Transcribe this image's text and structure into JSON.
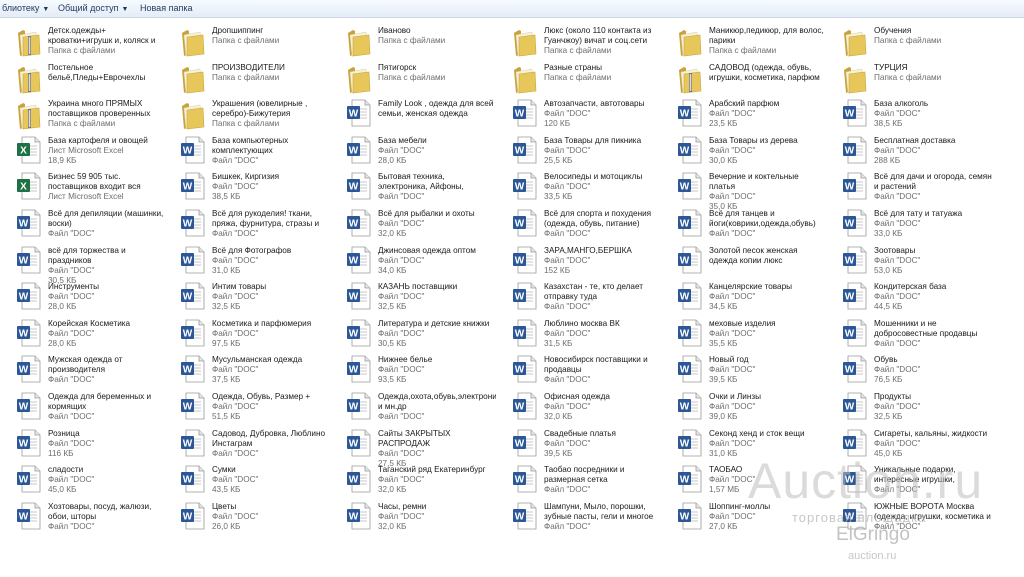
{
  "toolbar": {
    "buttons": [
      {
        "label": "блиотеку",
        "dropdown": true
      },
      {
        "label": "Общий доступ",
        "dropdown": true
      },
      {
        "label": "Новая папка",
        "dropdown": false
      }
    ]
  },
  "colors": {
    "folder": "#e8c75a",
    "word": "#2b5797",
    "excel": "#1e7145"
  },
  "files": [
    {
      "name": "Детск.одежды+ кроватки+игрушк и, коляск и многое другое",
      "sub": "Папка с файлами",
      "icon": "folder-zip-icon"
    },
    {
      "name": "Постельное бельё,Пледы+Еврочехлы",
      "sub": "",
      "icon": "folder-zip-icon"
    },
    {
      "name": "Украина много ПРЯМЫХ поставщиков проверенных",
      "sub": "Папка с файлами",
      "icon": "folder-zip-icon"
    },
    {
      "name": "База картофеля и овощей",
      "sub": "Лист Microsoft Excel",
      "size": "18,9 КБ",
      "icon": "excel-icon"
    },
    {
      "name": "Бизнес 59 905 тыс. поставщиков входит вся Россия",
      "sub": "Лист Microsoft Excel",
      "icon": "excel-icon"
    },
    {
      "name": "Всё для депиляции (машинки, воски)",
      "sub": "Файл \"DOC\"",
      "icon": "word-icon"
    },
    {
      "name": "всё для торжества и праздников",
      "sub": "Файл \"DOC\"",
      "size": "30,5 КБ",
      "icon": "word-icon"
    },
    {
      "name": "Инструменты",
      "sub": "Файл \"DOC\"",
      "size": "28,0 КБ",
      "icon": "word-icon"
    },
    {
      "name": "Корейская Косметика",
      "sub": "Файл \"DOC\"",
      "size": "28,0 КБ",
      "icon": "word-icon"
    },
    {
      "name": "Мужская одежда от производителя",
      "sub": "Файл \"DOC\"",
      "icon": "word-icon"
    },
    {
      "name": "Одежда для беременных и кормящих",
      "sub": "Файл \"DOC\"",
      "icon": "word-icon"
    },
    {
      "name": "Розница",
      "sub": "Файл \"DOC\"",
      "size": "116 КБ",
      "icon": "word-icon"
    },
    {
      "name": "сладости",
      "sub": "Файл \"DOC\"",
      "size": "45,0 КБ",
      "icon": "word-icon"
    },
    {
      "name": "Хозтовары, посуд, жалюзи, обои, шторы",
      "sub": "Файл \"DOC\"",
      "icon": "word-icon"
    },
    {
      "name": "Дропшиппинг",
      "sub": "Папка с файлами",
      "icon": "folder-icon"
    },
    {
      "name": "ПРОИЗВОДИТЕЛИ",
      "sub": "Папка с файлами",
      "icon": "folder-icon"
    },
    {
      "name": "Украшения (ювелирные , серебро)-Бижутерия",
      "sub": "Папка с файлами",
      "icon": "folder-icon"
    },
    {
      "name": "База компьютерных комплектующих",
      "sub": "Файл \"DOC\"",
      "icon": "word-icon"
    },
    {
      "name": "Бишкек, Киргизия",
      "sub": "Файл \"DOC\"",
      "size": "38,5 КБ",
      "icon": "word-icon"
    },
    {
      "name": "Всё для рукоделия! ткани, пряжа, фурнитура, стразы и многое др...",
      "sub": "Файл \"DOC\"",
      "icon": "word-icon"
    },
    {
      "name": "Всё для Фотографов",
      "sub": "Файл \"DOC\"",
      "size": "31,0 КБ",
      "icon": "word-icon"
    },
    {
      "name": "Интим товары",
      "sub": "Файл \"DOC\"",
      "size": "32,5 КБ",
      "icon": "word-icon"
    },
    {
      "name": "Косметика и парфюмерия",
      "sub": "Файл \"DOC\"",
      "size": "97,5 КБ",
      "icon": "word-icon"
    },
    {
      "name": "Мусульманская одежда",
      "sub": "Файл \"DOC\"",
      "size": "37,5 КБ",
      "icon": "word-icon"
    },
    {
      "name": "Одежда, Обувь, Размер +",
      "sub": "Файл \"DOC\"",
      "size": "51,5 КБ",
      "icon": "word-icon"
    },
    {
      "name": "Садовод, Дубровка, Люблино Инстаграм",
      "sub": "Файл \"DOC\"",
      "icon": "word-icon"
    },
    {
      "name": "Сумки",
      "sub": "Файл \"DOC\"",
      "size": "43,5 КБ",
      "icon": "word-icon"
    },
    {
      "name": "Цветы",
      "sub": "Файл \"DOC\"",
      "size": "26,0 КБ",
      "icon": "word-icon"
    },
    {
      "name": "Иваново",
      "sub": "Папка с файлами",
      "icon": "folder-icon"
    },
    {
      "name": "Пятигорск",
      "sub": "Папка с файлами",
      "icon": "folder-icon"
    },
    {
      "name": "Family Look , одежда для всей семьи, женская одежда",
      "sub": "",
      "icon": "word-icon"
    },
    {
      "name": "База мебели",
      "sub": "Файл \"DOC\"",
      "size": "28,0 КБ",
      "icon": "word-icon"
    },
    {
      "name": "Бытовая техника, электроника, Айфоны, смартфоны, самсунги",
      "sub": "Файл \"DOC\"",
      "icon": "word-icon"
    },
    {
      "name": "Всё для рыбалки и охоты",
      "sub": "Файл \"DOC\"",
      "size": "32,0 КБ",
      "icon": "word-icon"
    },
    {
      "name": "Джинсовая одежда оптом",
      "sub": "Файл \"DOC\"",
      "size": "34,0 КБ",
      "icon": "word-icon"
    },
    {
      "name": "КАЗАНЬ поставщики",
      "sub": "Файл \"DOC\"",
      "size": "32,5 КБ",
      "icon": "word-icon"
    },
    {
      "name": "Литература и детские книжки",
      "sub": "Файл \"DOC\"",
      "size": "30,5 КБ",
      "icon": "word-icon"
    },
    {
      "name": "Нижнее белье",
      "sub": "Файл \"DOC\"",
      "size": "93,5 КБ",
      "icon": "word-icon"
    },
    {
      "name": "Одежда,охота,обувь,электроника и мн.др",
      "sub": "Файл \"DOC\"",
      "icon": "word-icon"
    },
    {
      "name": "Сайты ЗАКРЫТЫХ РАСПРОДАЖ",
      "sub": "Файл \"DOC\"",
      "size": "27,5 КБ",
      "icon": "word-icon"
    },
    {
      "name": "Таганский ряд Екатеринбург",
      "sub": "Файл \"DOC\"",
      "size": "32,0 КБ",
      "icon": "word-icon"
    },
    {
      "name": "Часы, ремни",
      "sub": "Файл \"DOC\"",
      "size": "32,0 КБ",
      "icon": "word-icon"
    },
    {
      "name": "Люкс (около 110 контакта из Гуанчжоу) вичат и соц.сети",
      "sub": "Папка с файлами",
      "icon": "folder-icon"
    },
    {
      "name": "Разные страны",
      "sub": "Папка с файлами",
      "icon": "folder-icon"
    },
    {
      "name": "Автозапчасти, автотовары",
      "sub": "Файл \"DOC\"",
      "size": "120 КБ",
      "icon": "word-icon"
    },
    {
      "name": "База Товары для пикника",
      "sub": "Файл \"DOC\"",
      "size": "25,5 КБ",
      "icon": "word-icon"
    },
    {
      "name": "Велосипеды и мотоциклы",
      "sub": "Файл \"DOC\"",
      "size": "33,5 КБ",
      "icon": "word-icon"
    },
    {
      "name": "Всё для спорта и похудения (одежда, обувь, питание)",
      "sub": "Файл \"DOC\"",
      "icon": "word-icon"
    },
    {
      "name": "ЗАРА,МАНГО,БЕРШКА",
      "sub": "Файл \"DOC\"",
      "size": "152 КБ",
      "icon": "word-icon"
    },
    {
      "name": "Казахстан - те, кто делает отправку туда",
      "sub": "Файл \"DOC\"",
      "icon": "word-icon"
    },
    {
      "name": "Люблино москва ВК",
      "sub": "Файл \"DOC\"",
      "size": "31,5 КБ",
      "icon": "word-icon"
    },
    {
      "name": "Новосибирск поставщики и продавцы",
      "sub": "Файл \"DOC\"",
      "icon": "word-icon"
    },
    {
      "name": "Офисная одежда",
      "sub": "Файл \"DOC\"",
      "size": "32,0 КБ",
      "icon": "word-icon"
    },
    {
      "name": "Свадебные платья",
      "sub": "Файл \"DOC\"",
      "size": "39,5 КБ",
      "icon": "word-icon"
    },
    {
      "name": "Таобао посредники и размерная сетка",
      "sub": "Файл \"DOC\"",
      "icon": "word-icon"
    },
    {
      "name": "Шампуни, Мыло, порошки, зубные пасты, гели и многое др...",
      "sub": "Файл \"DOC\"",
      "icon": "word-icon"
    },
    {
      "name": "Маникюр,педикюр, для волос, парики",
      "sub": "Папка с файлами",
      "icon": "folder-icon"
    },
    {
      "name": "САДОВОД (одежда, обувь, игрушки, косметика, парфюм и...",
      "sub": "",
      "icon": "folder-zip-icon"
    },
    {
      "name": "Арабский парфюм",
      "sub": "Файл \"DOC\"",
      "size": "23,5 КБ",
      "icon": "word-icon"
    },
    {
      "name": "База Товары из дерева",
      "sub": "Файл \"DOC\"",
      "size": "30,0 КБ",
      "icon": "word-icon"
    },
    {
      "name": "Вечерние и коктельные платья",
      "sub": "Файл \"DOC\"",
      "size": "35,0 КБ",
      "icon": "word-icon"
    },
    {
      "name": "Всё для танцев и йоги(коврики,одежда,обувь)",
      "sub": "Файл \"DOC\"",
      "icon": "word-icon"
    },
    {
      "name": "Золотой песок женская одежда копии люкс",
      "sub": "",
      "icon": "word-icon"
    },
    {
      "name": "Канцелярские товары",
      "sub": "Файл \"DOC\"",
      "size": "34,5 КБ",
      "icon": "word-icon"
    },
    {
      "name": "меховые изделия",
      "sub": "Файл \"DOC\"",
      "size": "35,5 КБ",
      "icon": "word-icon"
    },
    {
      "name": "Новый год",
      "sub": "Файл \"DOC\"",
      "size": "39,5 КБ",
      "icon": "word-icon"
    },
    {
      "name": "Очки и Линзы",
      "sub": "Файл \"DOC\"",
      "size": "39,0 КБ",
      "icon": "word-icon"
    },
    {
      "name": "Секонд хенд и сток вещи",
      "sub": "Файл \"DOC\"",
      "size": "31,0 КБ",
      "icon": "word-icon"
    },
    {
      "name": "ТАОБАО",
      "sub": "Файл \"DOC\"",
      "size": "1,57 МБ",
      "icon": "word-icon"
    },
    {
      "name": "Шоппинг-моллы",
      "sub": "Файл \"DOC\"",
      "size": "27,0 КБ",
      "icon": "word-icon"
    },
    {
      "name": "Обучения",
      "sub": "Папка с файлами",
      "icon": "folder-icon"
    },
    {
      "name": "ТУРЦИЯ",
      "sub": "Папка с файлами",
      "icon": "folder-icon"
    },
    {
      "name": "База алкоголь",
      "sub": "Файл \"DOC\"",
      "size": "38,5 КБ",
      "icon": "word-icon"
    },
    {
      "name": "Бесплатная доставка",
      "sub": "Файл \"DOC\"",
      "size": "288 КБ",
      "icon": "word-icon"
    },
    {
      "name": "Всё для дачи и огорода, семян и растений",
      "sub": "Файл \"DOC\"",
      "icon": "word-icon"
    },
    {
      "name": "Всё для тату и татуажа",
      "sub": "Файл \"DOC\"",
      "size": "33,0 КБ",
      "icon": "word-icon"
    },
    {
      "name": "Зоотовары",
      "sub": "Файл \"DOC\"",
      "size": "53,0 КБ",
      "icon": "word-icon"
    },
    {
      "name": "Кондитерская база",
      "sub": "Файл \"DOC\"",
      "size": "44,5 КБ",
      "icon": "word-icon"
    },
    {
      "name": "Мошенники и не добросовестные продавцы",
      "sub": "Файл \"DOC\"",
      "icon": "word-icon"
    },
    {
      "name": "Обувь",
      "sub": "Файл \"DOC\"",
      "size": "76,5 КБ",
      "icon": "word-icon"
    },
    {
      "name": "Продукты",
      "sub": "Файл \"DOC\"",
      "size": "32,5 КБ",
      "icon": "word-icon"
    },
    {
      "name": "Сигареты, кальяны, жидкости",
      "sub": "Файл \"DOC\"",
      "size": "45,0 КБ",
      "icon": "word-icon"
    },
    {
      "name": "Уникальные подарки, интересные игрушки, украшени...",
      "sub": "Файл \"DOC\"",
      "icon": "word-icon"
    },
    {
      "name": "ЮЖНЫЕ ВОРОТА Москва (одежда, игрушки, косметика и ...",
      "sub": "Файл \"DOC\"",
      "icon": "word-icon"
    }
  ],
  "watermark": {
    "brand": "Auction.ru",
    "tagline": "торговая площадка",
    "user": "ElGringo",
    "url": "auction.ru"
  }
}
